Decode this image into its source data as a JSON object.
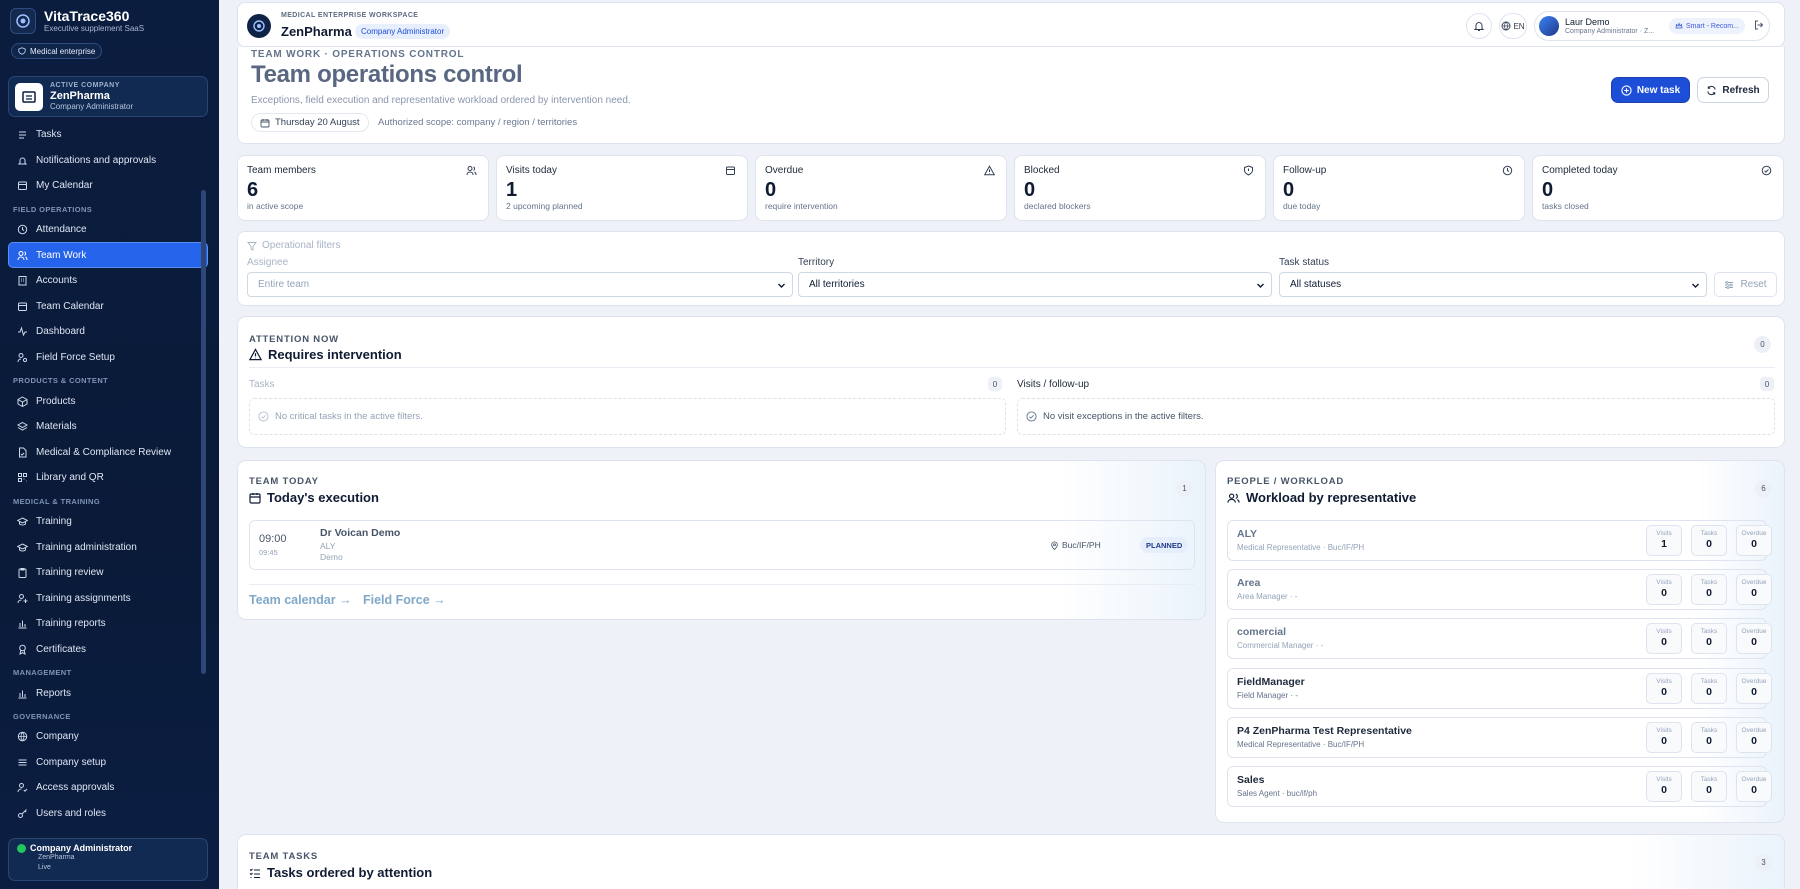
{
  "brand": {
    "name": "VitaTrace360",
    "tagline": "Executive supplement SaaS",
    "badge": "Medical enterprise"
  },
  "company_card": {
    "kicker": "ACTIVE COMPANY",
    "name": "ZenPharma",
    "role": "Company Administrator"
  },
  "nav": [
    {
      "type": "item",
      "label": "Tasks",
      "icon": "tasks-icon"
    },
    {
      "type": "item",
      "label": "Notifications and approvals",
      "icon": "bell-icon"
    },
    {
      "type": "item",
      "label": "My Calendar",
      "icon": "calendar-icon"
    },
    {
      "type": "section",
      "label": "FIELD OPERATIONS"
    },
    {
      "type": "item",
      "label": "Attendance",
      "icon": "clock-icon"
    },
    {
      "type": "item",
      "label": "Team Work",
      "icon": "users-icon",
      "active": true
    },
    {
      "type": "item",
      "label": "Accounts",
      "icon": "building-icon"
    },
    {
      "type": "item",
      "label": "Team Calendar",
      "icon": "calendar-icon"
    },
    {
      "type": "item",
      "label": "Dashboard",
      "icon": "activity-icon"
    },
    {
      "type": "item",
      "label": "Field Force Setup",
      "icon": "users-cog-icon"
    },
    {
      "type": "section",
      "label": "PRODUCTS & CONTENT"
    },
    {
      "type": "item",
      "label": "Products",
      "icon": "box-icon"
    },
    {
      "type": "item",
      "label": "Materials",
      "icon": "layers-icon"
    },
    {
      "type": "item",
      "label": "Medical & Compliance Review",
      "icon": "file-check-icon"
    },
    {
      "type": "item",
      "label": "Library and QR",
      "icon": "qr-icon"
    },
    {
      "type": "section",
      "label": "MEDICAL & TRAINING"
    },
    {
      "type": "item",
      "label": "Training",
      "icon": "graduation-icon"
    },
    {
      "type": "item",
      "label": "Training administration",
      "icon": "graduation-icon"
    },
    {
      "type": "item",
      "label": "Training review",
      "icon": "clipboard-icon"
    },
    {
      "type": "item",
      "label": "Training assignments",
      "icon": "user-plus-icon"
    },
    {
      "type": "item",
      "label": "Training reports",
      "icon": "bar-chart-icon"
    },
    {
      "type": "item",
      "label": "Certificates",
      "icon": "award-icon"
    },
    {
      "type": "section",
      "label": "MANAGEMENT"
    },
    {
      "type": "item",
      "label": "Reports",
      "icon": "bar-chart-icon"
    },
    {
      "type": "section",
      "label": "GOVERNANCE"
    },
    {
      "type": "item",
      "label": "Company",
      "icon": "globe-icon"
    },
    {
      "type": "item",
      "label": "Company setup",
      "icon": "sliders-icon"
    },
    {
      "type": "item",
      "label": "Access approvals",
      "icon": "user-check-icon"
    },
    {
      "type": "item",
      "label": "Users and roles",
      "icon": "key-icon"
    }
  ],
  "user_card": {
    "role": "Company Administrator",
    "company": "ZenPharma",
    "status": "Live"
  },
  "topbar": {
    "kicker": "MEDICAL ENTERPRISE WORKSPACE",
    "name": "ZenPharma",
    "badge": "Company Administrator",
    "lang": "EN",
    "user_name": "Laur Demo",
    "user_role": "Company Administrator · Z...",
    "chip": "Smart - Recom..."
  },
  "header": {
    "kicker": "TEAM WORK · OPERATIONS CONTROL",
    "title": "Team operations control",
    "subtitle": "Exceptions, field execution and representative workload ordered by intervention need.",
    "date": "Thursday 20 August",
    "scope": "Authorized scope: company / region / territories",
    "new_task": "New task",
    "refresh": "Refresh"
  },
  "stats": [
    {
      "label": "Team members",
      "value": "6",
      "hint": "in active scope",
      "icon": "users-icon"
    },
    {
      "label": "Visits today",
      "value": "1",
      "hint": "2 upcoming planned",
      "icon": "calendar-icon"
    },
    {
      "label": "Overdue",
      "value": "0",
      "hint": "require intervention",
      "icon": "alert-triangle-icon"
    },
    {
      "label": "Blocked",
      "value": "0",
      "hint": "declared blockers",
      "icon": "shield-icon"
    },
    {
      "label": "Follow-up",
      "value": "0",
      "hint": "due today",
      "icon": "clock-icon"
    },
    {
      "label": "Completed today",
      "value": "0",
      "hint": "tasks closed",
      "icon": "check-circle-icon"
    }
  ],
  "filters": {
    "title": "Operational filters",
    "assignee_label": "Assignee",
    "assignee_value": "Entire team",
    "territory_label": "Territory",
    "territory_value": "All territories",
    "status_label": "Task status",
    "status_value": "All statuses",
    "reset": "Reset"
  },
  "attention": {
    "kicker": "ATTENTION NOW",
    "title": "Requires intervention",
    "count": "0",
    "tasks_label": "Tasks",
    "tasks_count": "0",
    "tasks_empty": "No critical tasks in the active filters.",
    "visits_label": "Visits / follow-up",
    "visits_count": "0",
    "visits_empty": "No visit exceptions in the active filters."
  },
  "today": {
    "kicker": "TEAM TODAY",
    "title": "Today's execution",
    "count": "1",
    "visit": {
      "time": "09:00",
      "end": "09:45",
      "doctor": "Dr Voican Demo",
      "rep": "ALY",
      "account": "Demo",
      "location": "Buc/IF/PH",
      "status": "PLANNED"
    },
    "link1": "Team calendar →",
    "link2": "Field Force →"
  },
  "workload": {
    "kicker": "PEOPLE / WORKLOAD",
    "title": "Workload by representative",
    "count": "6",
    "col_visits": "Visits",
    "col_tasks": "Tasks",
    "col_overdue": "Overdue",
    "reps": [
      {
        "name": "ALY",
        "sub": "Medical Representative · Buc/IF/PH",
        "visits": "1",
        "tasks": "0",
        "overdue": "0",
        "muted": true
      },
      {
        "name": "Area",
        "sub": "Area Manager · -",
        "visits": "0",
        "tasks": "0",
        "overdue": "0",
        "muted": true
      },
      {
        "name": "comercial",
        "sub": "Commercial Manager · -",
        "visits": "0",
        "tasks": "0",
        "overdue": "0",
        "muted": true
      },
      {
        "name": "FieldManager",
        "sub": "Field Manager · -",
        "visits": "0",
        "tasks": "0",
        "overdue": "0",
        "muted": false
      },
      {
        "name": "P4 ZenPharma Test Representative",
        "sub": "Medical Representative · Buc/IF/PH",
        "visits": "0",
        "tasks": "0",
        "overdue": "0",
        "muted": false
      },
      {
        "name": "Sales",
        "sub": "Sales Agent · buc/if/ph",
        "visits": "0",
        "tasks": "0",
        "overdue": "0",
        "muted": false
      }
    ]
  },
  "team_tasks": {
    "kicker": "TEAM TASKS",
    "title": "Tasks ordered by attention",
    "count": "3"
  }
}
